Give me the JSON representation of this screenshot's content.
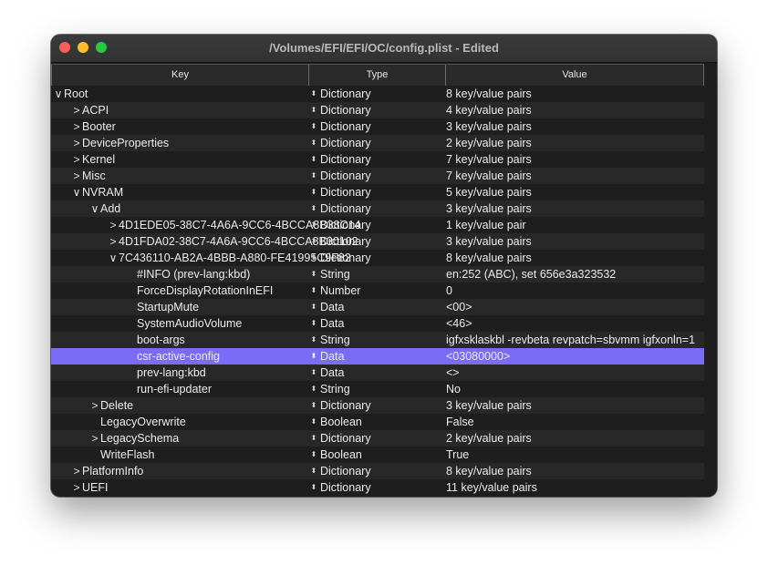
{
  "window": {
    "title": "/Volumes/EFI/EFI/OC/config.plist - Edited"
  },
  "columns": {
    "key": "Key",
    "type": "Type",
    "value": "Value"
  },
  "rows": [
    {
      "key": "Root",
      "type": "Dictionary",
      "value": "8 key/value pairs",
      "depth": 0,
      "disclosure": "open",
      "selected": false
    },
    {
      "key": "ACPI",
      "type": "Dictionary",
      "value": "4 key/value pairs",
      "depth": 1,
      "disclosure": "closed",
      "selected": false
    },
    {
      "key": "Booter",
      "type": "Dictionary",
      "value": "3 key/value pairs",
      "depth": 1,
      "disclosure": "closed",
      "selected": false
    },
    {
      "key": "DeviceProperties",
      "type": "Dictionary",
      "value": "2 key/value pairs",
      "depth": 1,
      "disclosure": "closed",
      "selected": false
    },
    {
      "key": "Kernel",
      "type": "Dictionary",
      "value": "7 key/value pairs",
      "depth": 1,
      "disclosure": "closed",
      "selected": false
    },
    {
      "key": "Misc",
      "type": "Dictionary",
      "value": "7 key/value pairs",
      "depth": 1,
      "disclosure": "closed",
      "selected": false
    },
    {
      "key": "NVRAM",
      "type": "Dictionary",
      "value": "5 key/value pairs",
      "depth": 1,
      "disclosure": "open",
      "selected": false
    },
    {
      "key": "Add",
      "type": "Dictionary",
      "value": "3 key/value pairs",
      "depth": 2,
      "disclosure": "open",
      "selected": false
    },
    {
      "key": "4D1EDE05-38C7-4A6A-9CC6-4BCCA8B38C14",
      "type": "Dictionary",
      "value": "1 key/value pair",
      "depth": 3,
      "disclosure": "closed",
      "selected": false
    },
    {
      "key": "4D1FDA02-38C7-4A6A-9CC6-4BCCA8B30102",
      "type": "Dictionary",
      "value": "3 key/value pairs",
      "depth": 3,
      "disclosure": "closed",
      "selected": false
    },
    {
      "key": "7C436110-AB2A-4BBB-A880-FE41995C9F82",
      "type": "Dictionary",
      "value": "8 key/value pairs",
      "depth": 3,
      "disclosure": "open",
      "selected": false
    },
    {
      "key": "#INFO (prev-lang:kbd)",
      "type": "String",
      "value": "en:252 (ABC), set 656e3a323532",
      "depth": 4,
      "disclosure": "none",
      "selected": false
    },
    {
      "key": "ForceDisplayRotationInEFI",
      "type": "Number",
      "value": "0",
      "depth": 4,
      "disclosure": "none",
      "selected": false
    },
    {
      "key": "StartupMute",
      "type": "Data",
      "value": "<00>",
      "depth": 4,
      "disclosure": "none",
      "selected": false
    },
    {
      "key": "SystemAudioVolume",
      "type": "Data",
      "value": "<46>",
      "depth": 4,
      "disclosure": "none",
      "selected": false
    },
    {
      "key": "boot-args",
      "type": "String",
      "value": "igfxsklaskbl -revbeta revpatch=sbvmm igfxonln=1",
      "depth": 4,
      "disclosure": "none",
      "selected": false
    },
    {
      "key": "csr-active-config",
      "type": "Data",
      "value": "<03080000>",
      "depth": 4,
      "disclosure": "none",
      "selected": true
    },
    {
      "key": "prev-lang:kbd",
      "type": "Data",
      "value": "<>",
      "depth": 4,
      "disclosure": "none",
      "selected": false
    },
    {
      "key": "run-efi-updater",
      "type": "String",
      "value": "No",
      "depth": 4,
      "disclosure": "none",
      "selected": false
    },
    {
      "key": "Delete",
      "type": "Dictionary",
      "value": "3 key/value pairs",
      "depth": 2,
      "disclosure": "closed",
      "selected": false
    },
    {
      "key": "LegacyOverwrite",
      "type": "Boolean",
      "value": "False",
      "depth": 2,
      "disclosure": "none",
      "selected": false
    },
    {
      "key": "LegacySchema",
      "type": "Dictionary",
      "value": "2 key/value pairs",
      "depth": 2,
      "disclosure": "closed",
      "selected": false
    },
    {
      "key": "WriteFlash",
      "type": "Boolean",
      "value": "True",
      "depth": 2,
      "disclosure": "none",
      "selected": false
    },
    {
      "key": "PlatformInfo",
      "type": "Dictionary",
      "value": "8 key/value pairs",
      "depth": 1,
      "disclosure": "closed",
      "selected": false
    },
    {
      "key": "UEFI",
      "type": "Dictionary",
      "value": "11 key/value pairs",
      "depth": 1,
      "disclosure": "closed",
      "selected": false
    }
  ],
  "icons": {
    "disclosure_open": "∨",
    "disclosure_closed": ">",
    "type_stepper": "⬍"
  },
  "colors": {
    "selection": "#7a6cf5",
    "row_even": "#282828",
    "row_odd": "#1e1e1e"
  }
}
